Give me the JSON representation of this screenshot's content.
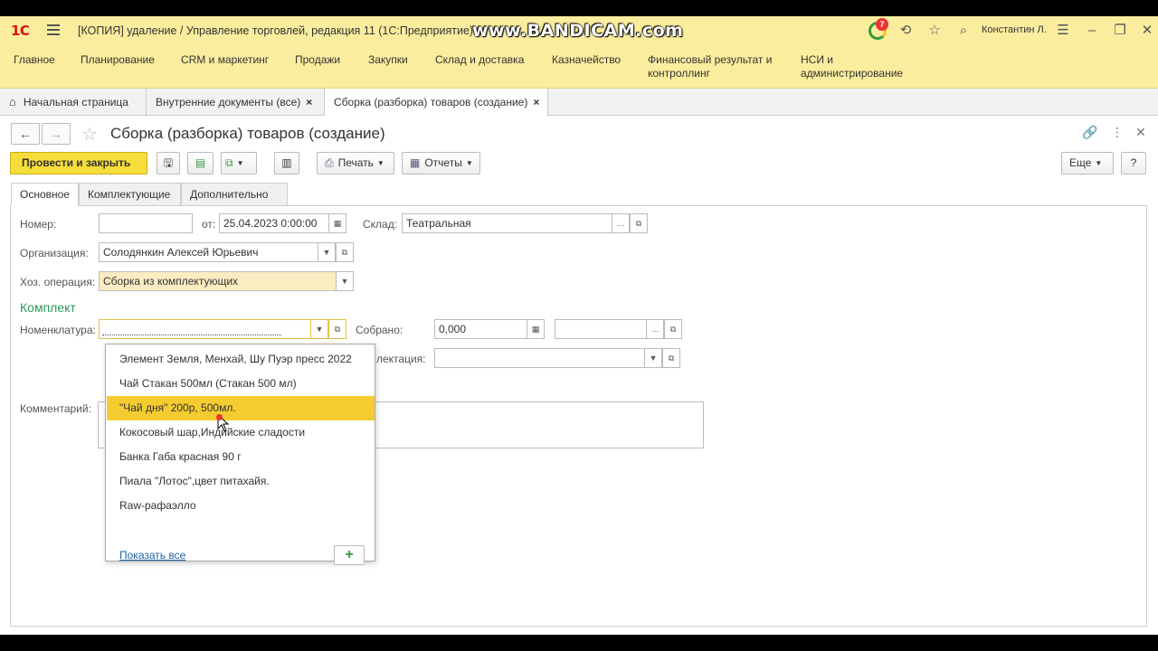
{
  "app": {
    "logo": "1С",
    "title": "[КОПИЯ] удаление / Управление торговлей, редакция 11  (1С:Предприятие)",
    "watermark": "www.BANDICAM.com",
    "notification_count": "7",
    "user": "Константин Л."
  },
  "menu": [
    {
      "label": "Главное"
    },
    {
      "label": "Планирование"
    },
    {
      "label": "CRM и маркетинг"
    },
    {
      "label": "Продажи"
    },
    {
      "label": "Закупки"
    },
    {
      "label": "Склад и доставка"
    },
    {
      "label": "Казначейство"
    },
    {
      "label": "Финансовый результат и контроллинг"
    },
    {
      "label": "НСИ и администрирование"
    }
  ],
  "tabs": [
    {
      "label": "Начальная страница"
    },
    {
      "label": "Внутренние документы (все)"
    },
    {
      "label": "Сборка (разборка) товаров (создание)"
    }
  ],
  "form": {
    "title": "Сборка (разборка) товаров (создание)",
    "toolbar": {
      "post_close": "Провести и закрыть",
      "print": "Печать",
      "reports": "Отчеты",
      "more": "Еще",
      "help": "?"
    },
    "form_tabs": [
      {
        "label": "Основное"
      },
      {
        "label": "Комплектующие"
      },
      {
        "label": "Дополнительно"
      }
    ],
    "fields": {
      "number_label": "Номер:",
      "number_value": "",
      "date_label": "от:",
      "date_value": "25.04.2023  0:00:00",
      "warehouse_label": "Склад:",
      "warehouse_value": "Театральная",
      "org_label": "Организация:",
      "org_value": "Солодянкин Алексей Юрьевич",
      "operation_label": "Хоз. операция:",
      "operation_value": "Сборка из комплектующих",
      "kit_section": "Комплект",
      "nomenclature_label": "Номенклатура:",
      "nomenclature_value": "",
      "collected_label": "Собрано:",
      "collected_value": "0,000",
      "collected_unit": "",
      "spec_label": "лектация:",
      "spec_value": "",
      "comment_label": "Комментарий:",
      "comment_value": ""
    }
  },
  "dropdown": {
    "items": [
      "Элемент Земля, Менхай,  Шу Пуэр пресс 2022",
      "Чай Стакан 500мл (Стакан 500 мл)",
      "\"Чай дня\" 200р, 500мл.",
      "Кокосовый шар,Индийские сладости",
      "Банка Габа красная 90 г",
      "Пиала \"Лотос\",цвет питахайя.",
      "Raw-рафаэлло"
    ],
    "highlighted_index": 2,
    "show_all": "Показать все"
  },
  "colors": {
    "header_bg": "#fbed9e",
    "primary_button": "#f7dd3a",
    "section_title": "#2a9a5a",
    "highlight": "#f5cc30"
  }
}
